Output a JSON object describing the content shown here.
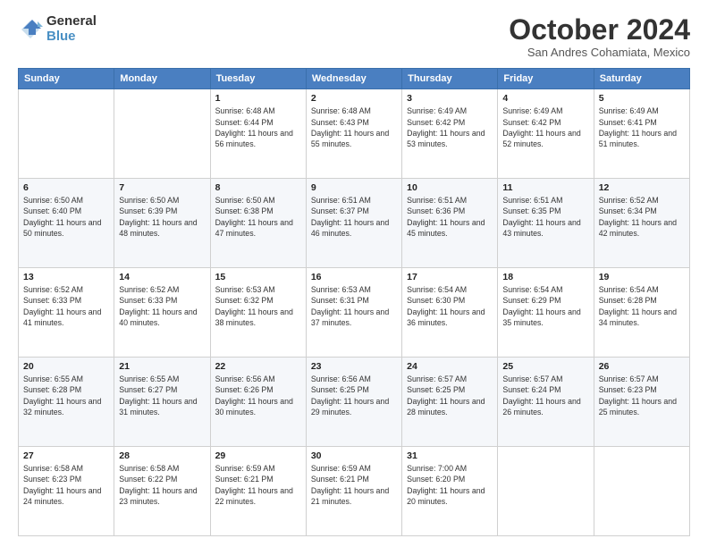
{
  "header": {
    "logo_general": "General",
    "logo_blue": "Blue",
    "month_title": "October 2024",
    "location": "San Andres Cohamiata, Mexico"
  },
  "weekdays": [
    "Sunday",
    "Monday",
    "Tuesday",
    "Wednesday",
    "Thursday",
    "Friday",
    "Saturday"
  ],
  "weeks": [
    [
      {
        "day": "",
        "info": ""
      },
      {
        "day": "",
        "info": ""
      },
      {
        "day": "1",
        "info": "Sunrise: 6:48 AM\nSunset: 6:44 PM\nDaylight: 11 hours and 56 minutes."
      },
      {
        "day": "2",
        "info": "Sunrise: 6:48 AM\nSunset: 6:43 PM\nDaylight: 11 hours and 55 minutes."
      },
      {
        "day": "3",
        "info": "Sunrise: 6:49 AM\nSunset: 6:42 PM\nDaylight: 11 hours and 53 minutes."
      },
      {
        "day": "4",
        "info": "Sunrise: 6:49 AM\nSunset: 6:42 PM\nDaylight: 11 hours and 52 minutes."
      },
      {
        "day": "5",
        "info": "Sunrise: 6:49 AM\nSunset: 6:41 PM\nDaylight: 11 hours and 51 minutes."
      }
    ],
    [
      {
        "day": "6",
        "info": "Sunrise: 6:50 AM\nSunset: 6:40 PM\nDaylight: 11 hours and 50 minutes."
      },
      {
        "day": "7",
        "info": "Sunrise: 6:50 AM\nSunset: 6:39 PM\nDaylight: 11 hours and 48 minutes."
      },
      {
        "day": "8",
        "info": "Sunrise: 6:50 AM\nSunset: 6:38 PM\nDaylight: 11 hours and 47 minutes."
      },
      {
        "day": "9",
        "info": "Sunrise: 6:51 AM\nSunset: 6:37 PM\nDaylight: 11 hours and 46 minutes."
      },
      {
        "day": "10",
        "info": "Sunrise: 6:51 AM\nSunset: 6:36 PM\nDaylight: 11 hours and 45 minutes."
      },
      {
        "day": "11",
        "info": "Sunrise: 6:51 AM\nSunset: 6:35 PM\nDaylight: 11 hours and 43 minutes."
      },
      {
        "day": "12",
        "info": "Sunrise: 6:52 AM\nSunset: 6:34 PM\nDaylight: 11 hours and 42 minutes."
      }
    ],
    [
      {
        "day": "13",
        "info": "Sunrise: 6:52 AM\nSunset: 6:33 PM\nDaylight: 11 hours and 41 minutes."
      },
      {
        "day": "14",
        "info": "Sunrise: 6:52 AM\nSunset: 6:33 PM\nDaylight: 11 hours and 40 minutes."
      },
      {
        "day": "15",
        "info": "Sunrise: 6:53 AM\nSunset: 6:32 PM\nDaylight: 11 hours and 38 minutes."
      },
      {
        "day": "16",
        "info": "Sunrise: 6:53 AM\nSunset: 6:31 PM\nDaylight: 11 hours and 37 minutes."
      },
      {
        "day": "17",
        "info": "Sunrise: 6:54 AM\nSunset: 6:30 PM\nDaylight: 11 hours and 36 minutes."
      },
      {
        "day": "18",
        "info": "Sunrise: 6:54 AM\nSunset: 6:29 PM\nDaylight: 11 hours and 35 minutes."
      },
      {
        "day": "19",
        "info": "Sunrise: 6:54 AM\nSunset: 6:28 PM\nDaylight: 11 hours and 34 minutes."
      }
    ],
    [
      {
        "day": "20",
        "info": "Sunrise: 6:55 AM\nSunset: 6:28 PM\nDaylight: 11 hours and 32 minutes."
      },
      {
        "day": "21",
        "info": "Sunrise: 6:55 AM\nSunset: 6:27 PM\nDaylight: 11 hours and 31 minutes."
      },
      {
        "day": "22",
        "info": "Sunrise: 6:56 AM\nSunset: 6:26 PM\nDaylight: 11 hours and 30 minutes."
      },
      {
        "day": "23",
        "info": "Sunrise: 6:56 AM\nSunset: 6:25 PM\nDaylight: 11 hours and 29 minutes."
      },
      {
        "day": "24",
        "info": "Sunrise: 6:57 AM\nSunset: 6:25 PM\nDaylight: 11 hours and 28 minutes."
      },
      {
        "day": "25",
        "info": "Sunrise: 6:57 AM\nSunset: 6:24 PM\nDaylight: 11 hours and 26 minutes."
      },
      {
        "day": "26",
        "info": "Sunrise: 6:57 AM\nSunset: 6:23 PM\nDaylight: 11 hours and 25 minutes."
      }
    ],
    [
      {
        "day": "27",
        "info": "Sunrise: 6:58 AM\nSunset: 6:23 PM\nDaylight: 11 hours and 24 minutes."
      },
      {
        "day": "28",
        "info": "Sunrise: 6:58 AM\nSunset: 6:22 PM\nDaylight: 11 hours and 23 minutes."
      },
      {
        "day": "29",
        "info": "Sunrise: 6:59 AM\nSunset: 6:21 PM\nDaylight: 11 hours and 22 minutes."
      },
      {
        "day": "30",
        "info": "Sunrise: 6:59 AM\nSunset: 6:21 PM\nDaylight: 11 hours and 21 minutes."
      },
      {
        "day": "31",
        "info": "Sunrise: 7:00 AM\nSunset: 6:20 PM\nDaylight: 11 hours and 20 minutes."
      },
      {
        "day": "",
        "info": ""
      },
      {
        "day": "",
        "info": ""
      }
    ]
  ]
}
